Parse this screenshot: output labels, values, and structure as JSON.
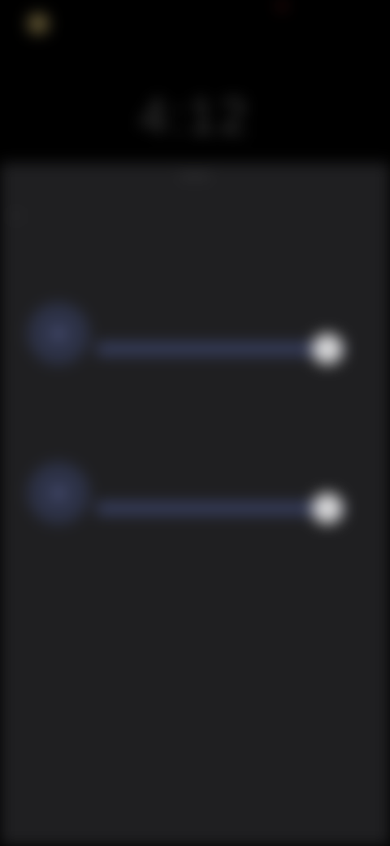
{
  "status_bar": {
    "app_label": "",
    "clock": "4:12"
  },
  "sheet": {
    "title": "",
    "description": "",
    "sliders": [
      {
        "label": "",
        "level": 0.92
      },
      {
        "label": "",
        "level": 0.92
      }
    ],
    "section_label": "",
    "footer_note": ""
  },
  "colors": {
    "background": "#000000",
    "sheet": "#1f1f21",
    "accent": "#3a4266",
    "thumb": "#d8d8da"
  },
  "icons": {
    "back": "back-arrow-icon",
    "slider_1": "brightness-icon",
    "slider_2": "night-light-icon"
  }
}
